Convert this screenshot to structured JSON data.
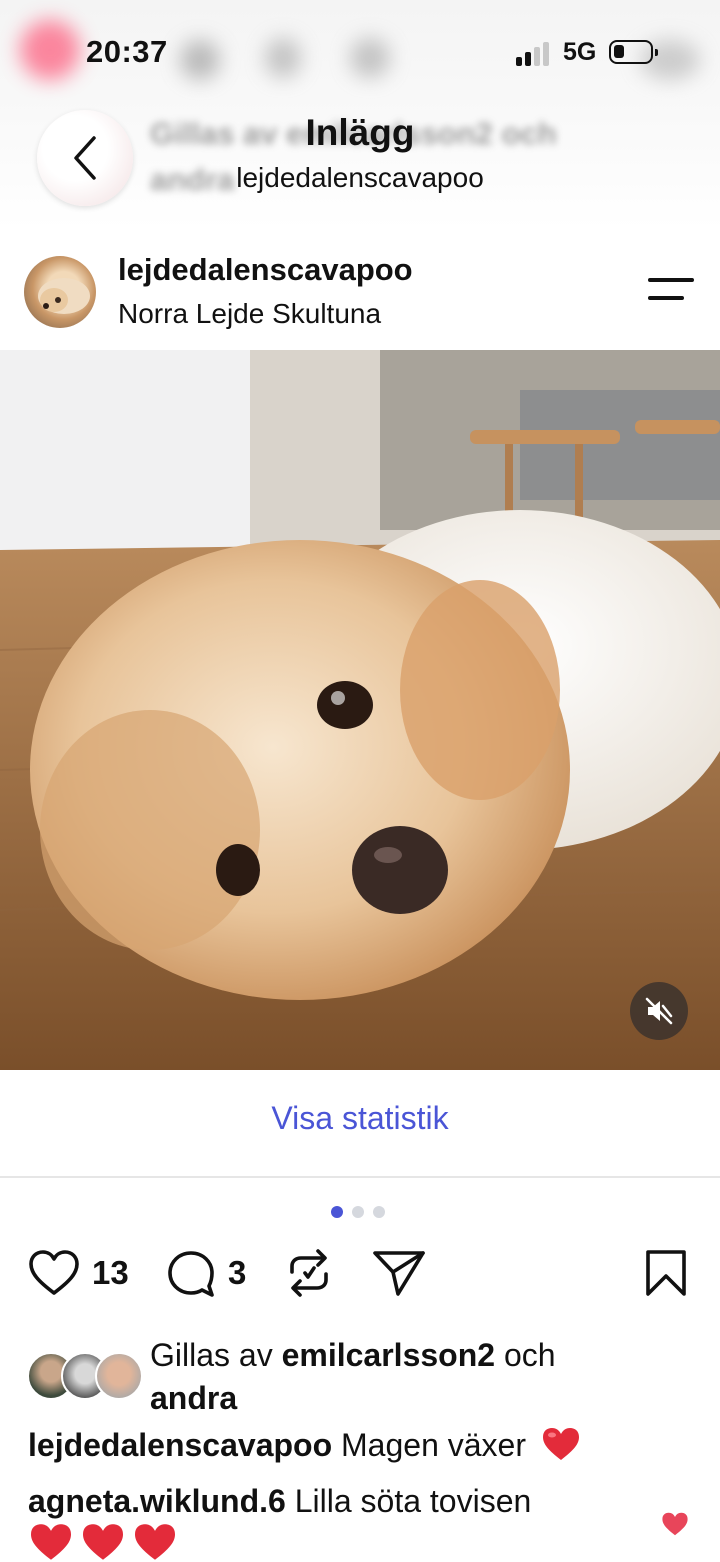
{
  "status_bar": {
    "time": "20:37",
    "network": "5G"
  },
  "header": {
    "title": "Inlägg",
    "subtitle": "lejdedalenscavapoo"
  },
  "post": {
    "username": "lejdedalenscavapoo",
    "location": "Norra Lejde Skultuna",
    "stats_link": "Visa statistik",
    "carousel": {
      "current": 1,
      "total": 3
    },
    "likes_count": "13",
    "comments_count": "3",
    "liked_by": {
      "prefix": "Gillas av",
      "user": "emilcarlsson2",
      "connector": "och",
      "others": "andra"
    },
    "caption": {
      "user": "lejdedalenscavapoo",
      "text": "Magen växer"
    },
    "comment": {
      "user": "agneta.wiklund.6",
      "text": "Lilla söta tovisen"
    }
  },
  "icons": {
    "back": "chevron-left-icon",
    "menu": "menu-icon",
    "mute": "muted-speaker-icon",
    "like": "heart-icon",
    "comment": "comment-bubble-icon",
    "repost": "repost-icon",
    "share": "send-icon",
    "save": "bookmark-icon"
  },
  "colors": {
    "accent": "#4a55d6",
    "heart": "#e32b3a"
  }
}
